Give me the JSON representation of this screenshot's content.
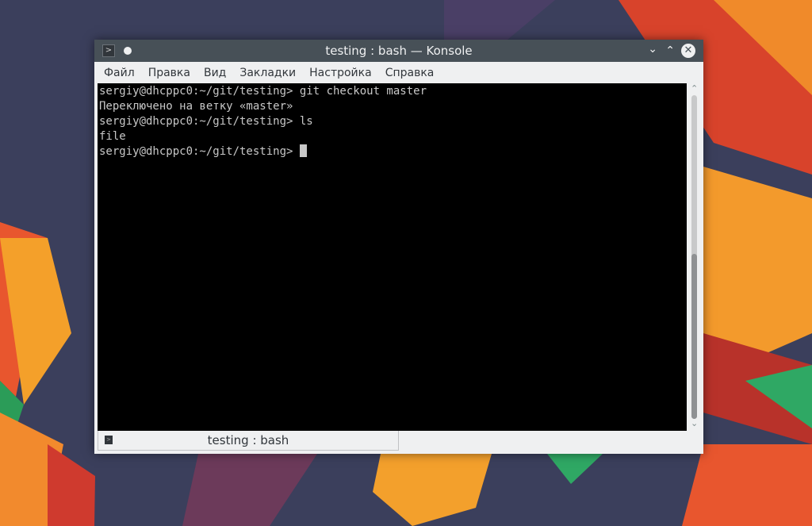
{
  "window": {
    "title": "testing : bash — Konsole",
    "icon": "terminal-icon",
    "buttons": [
      "minimize",
      "maximize",
      "close"
    ]
  },
  "menu": [
    "Файл",
    "Правка",
    "Вид",
    "Закладки",
    "Настройка",
    "Справка"
  ],
  "terminal": {
    "lines": [
      "sergiy@dhcppc0:~/git/testing> git checkout master",
      "Переключено на ветку «master»",
      "sergiy@dhcppc0:~/git/testing> ls",
      "file",
      "sergiy@dhcppc0:~/git/testing> "
    ]
  },
  "scrollbar": {
    "position_fraction": 1.0
  },
  "tabs": [
    {
      "label": "testing : bash"
    }
  ]
}
